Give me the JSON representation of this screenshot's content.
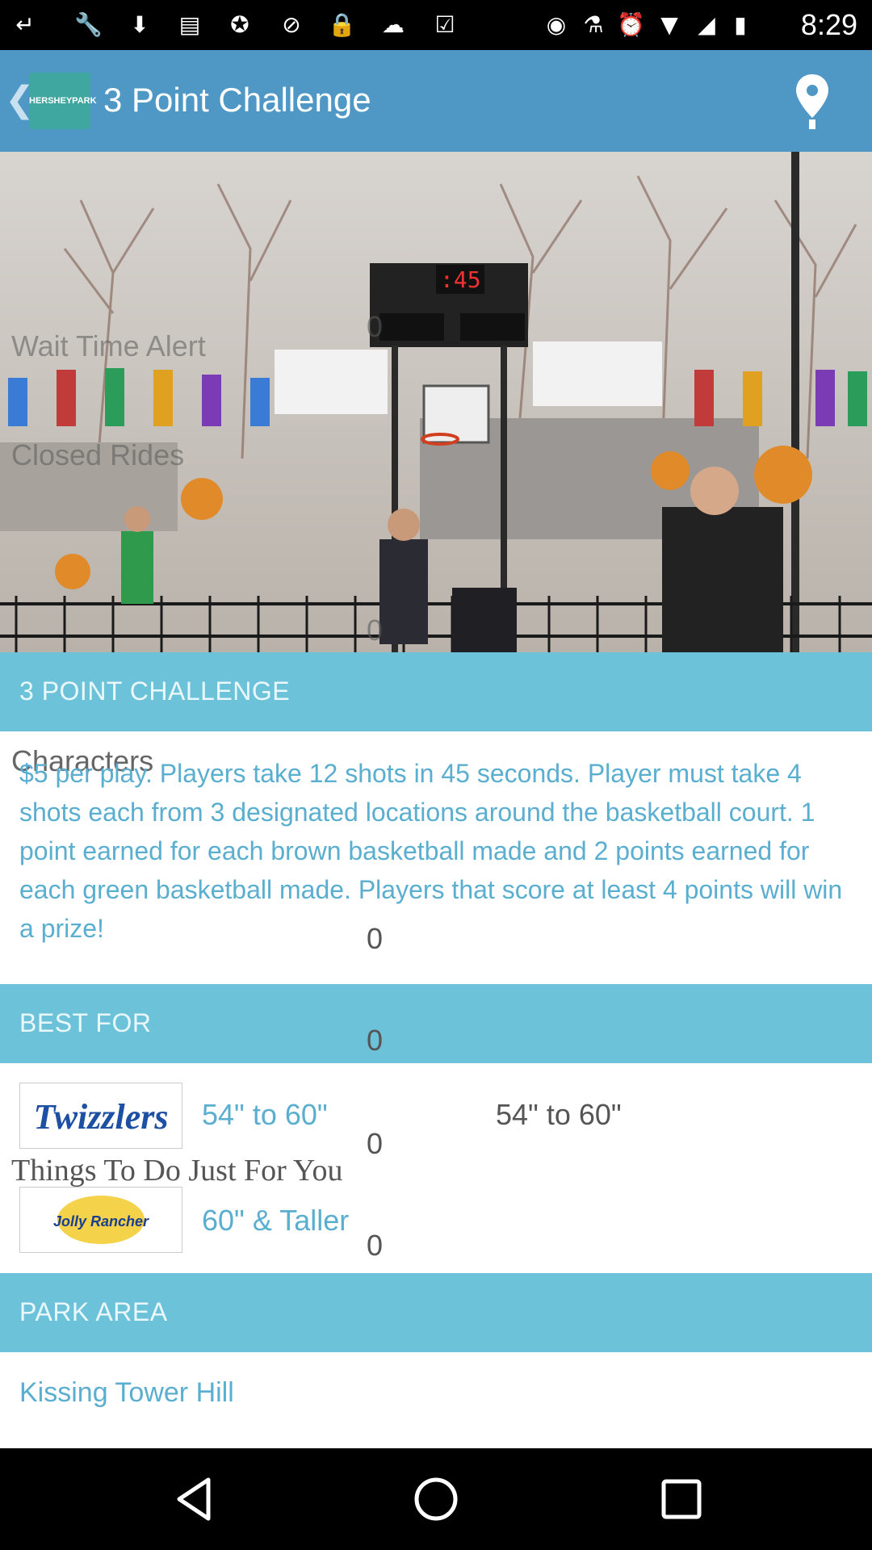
{
  "status_bar": {
    "time": "8:29",
    "icons": [
      "notification-icon",
      "wrench-icon",
      "download-icon",
      "news-icon",
      "fake-gps-icon",
      "do-not-disturb-icon",
      "lock-icon",
      "cloud-icon",
      "checklist-icon",
      "location-icon",
      "bluetooth-icon",
      "alarm-icon",
      "wifi-icon",
      "signal-icon",
      "battery-icon"
    ]
  },
  "app_bar": {
    "title": "3 Point Challenge",
    "logo_text": "HERSHEYPARK"
  },
  "hero": {
    "overlay_1": "Wait Time Alert",
    "overlay_2": "Closed Rides",
    "zero_top": "0",
    "zero_bottom": "0"
  },
  "section_1": {
    "label": "3 POINT CHALLENGE"
  },
  "characters_overlay": "Characters",
  "description": "$5 per play.  Players take 12 shots in 45 seconds.  Player must take 4 shots each from 3 designated locations around the basketball court.  1 point earned for each brown basketball made and 2 points earned for each green basketball made. Players that score at least 4 points will win a prize!",
  "desc_zero": "0",
  "section_2": {
    "label": "BEST FOR",
    "zero": "0"
  },
  "best_for": [
    {
      "brand": "Twizzlers",
      "range": "54\" to 60\"",
      "zero": "0"
    },
    {
      "brand": "Jolly Rancher",
      "range": "60\" & Taller",
      "zero": "0"
    }
  ],
  "range_right": "54\" to 60\"",
  "things_overlay": "Things To Do Just For You",
  "section_3": {
    "label": "PARK AREA"
  },
  "park_area": "Kissing Tower Hill",
  "colors": {
    "app_bar": "#4f98c6",
    "section": "#6cc3d9",
    "link_text": "#5aaed0"
  }
}
